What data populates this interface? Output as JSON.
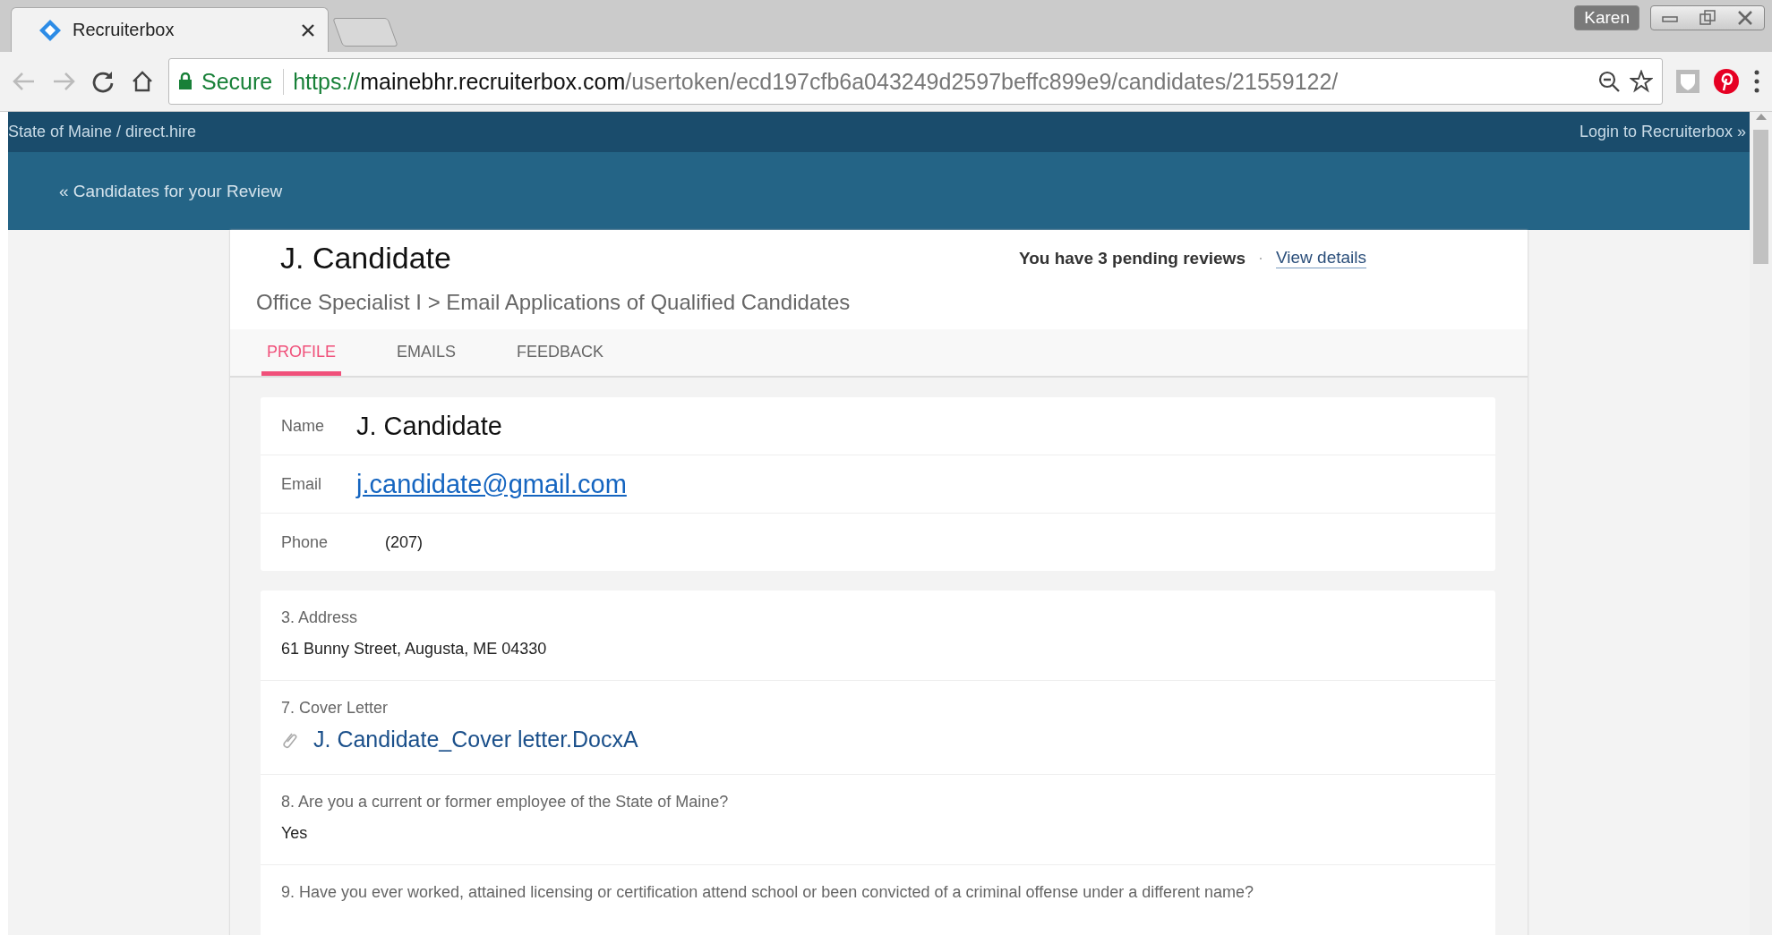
{
  "browser": {
    "tab_title": "Recruiterbox",
    "profile": "Karen",
    "secure_label": "Secure",
    "url_scheme": "https://",
    "url_host": "mainebhr.recruiterbox.com",
    "url_path": "/usertoken/ecd197cfb6a043249d2597beffc899e9/candidates/21559122/"
  },
  "topbar": {
    "org": "State of Maine / direct.hire",
    "login": "Login to Recruiterbox »"
  },
  "back_link": "« Candidates for your Review",
  "candidate": {
    "name": "J. Candidate",
    "pending": "You have 3 pending reviews",
    "separator": "·",
    "view_details": "View details",
    "job_path": "Office Specialist I > Email Applications of Qualified Candidates"
  },
  "tabs": [
    {
      "label": "PROFILE",
      "selected": true
    },
    {
      "label": "EMAILS",
      "selected": false
    },
    {
      "label": "FEEDBACK",
      "selected": false
    }
  ],
  "contact_fields": [
    {
      "label": "Name",
      "value": "J. Candidate",
      "kind": "text"
    },
    {
      "label": "Email",
      "value": "j.candidate@gmail.com",
      "kind": "link"
    },
    {
      "label": "Phone",
      "value": "(207)",
      "kind": "small"
    }
  ],
  "questions": [
    {
      "label": "3. Address",
      "answer": "61 Bunny Street, Augusta, ME 04330",
      "kind": "text"
    },
    {
      "label": "7. Cover Letter",
      "answer": "J. Candidate_Cover letter.DocxA",
      "kind": "attachment"
    },
    {
      "label": "8. Are you a current or former employee of the State of Maine?",
      "answer": "Yes",
      "kind": "text"
    },
    {
      "label": "9. Have you ever worked, attained licensing or certification attend school or been convicted of a criminal offense under a different name?",
      "kind": "text"
    }
  ]
}
